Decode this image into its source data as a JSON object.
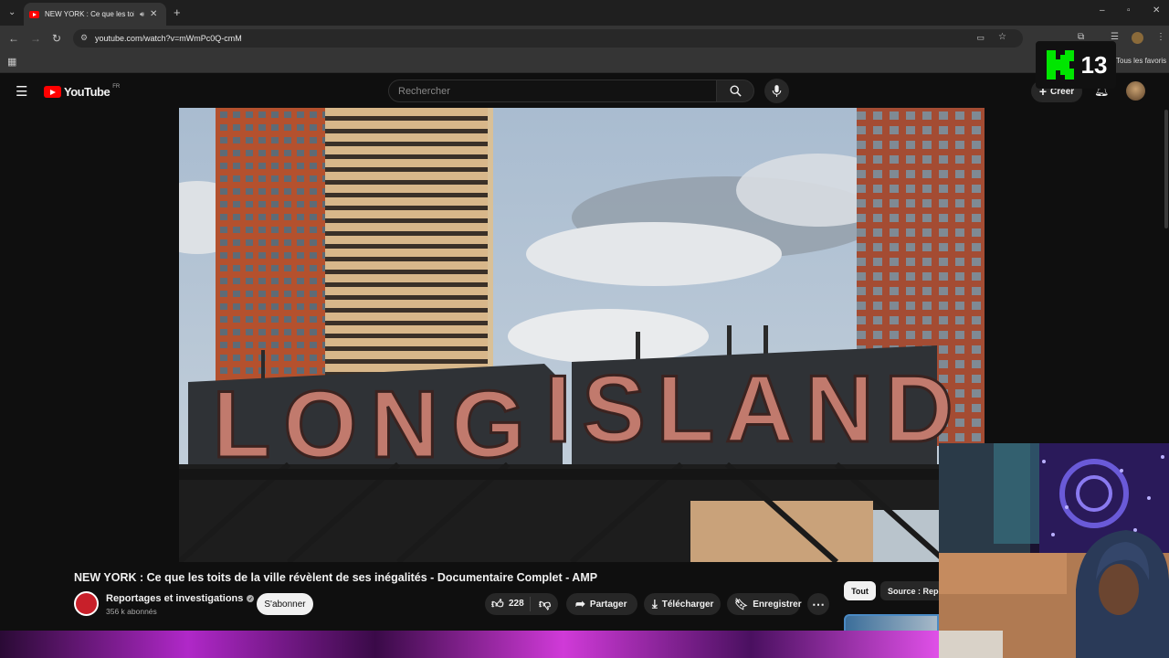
{
  "browser": {
    "tab_title": "NEW YORK : Ce que les toits",
    "url": "youtube.com/watch?v=mWmPc0Q-cmM",
    "bookmarks_all": "Tous les favoris"
  },
  "youtube": {
    "logo_text": "YouTube",
    "region": "FR",
    "search_placeholder": "Rechercher",
    "create_label": "Créer"
  },
  "overlay": {
    "badge_number": "13"
  },
  "video": {
    "sign_text": "LONG ISLAND",
    "title": "NEW YORK : Ce que les toits de la ville révèlent de ses inégalités - Documentaire Complet - AMP",
    "channel": "Reportages et investigations",
    "subscribers": "356 k abonnés",
    "subscribe_label": "S'abonner",
    "likes": "228",
    "share_label": "Partager",
    "download_label": "Télécharger",
    "save_label": "Enregistrer"
  },
  "recommendations": {
    "chips": [
      "Tout",
      "Source : Repo"
    ]
  },
  "colors": {
    "background": "#0f0f0f",
    "yt_red": "#ff0000",
    "overlay_green": "#00e600"
  }
}
